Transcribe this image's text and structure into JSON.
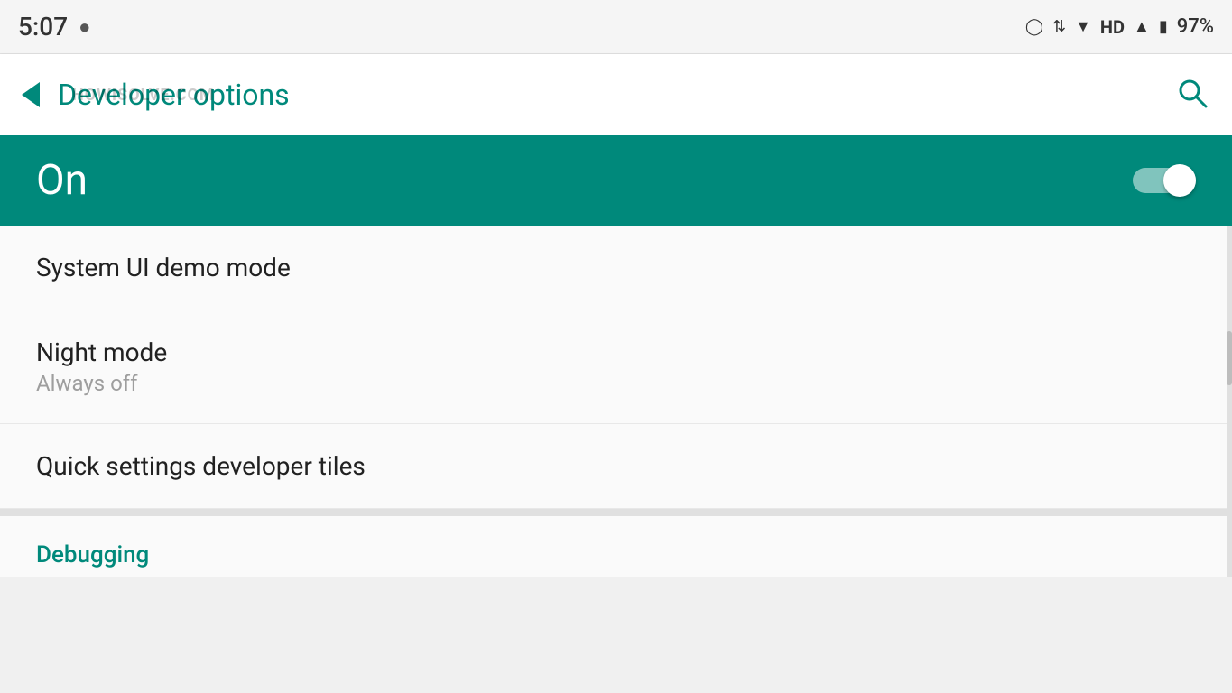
{
  "statusBar": {
    "time": "5:07",
    "batteryPercent": "97%",
    "icons": {
      "alarm": "⏰",
      "sort": "⇅",
      "wifi": "▾",
      "hd": "HD",
      "signal": "▲",
      "battery": "🔋"
    }
  },
  "appBar": {
    "title": "Developer options",
    "backLabel": "←",
    "searchLabel": "🔍"
  },
  "onBanner": {
    "label": "On",
    "toggleState": "on"
  },
  "settings": [
    {
      "id": "system-ui-demo",
      "title": "System UI demo mode",
      "subtitle": ""
    },
    {
      "id": "night-mode",
      "title": "Night mode",
      "subtitle": "Always off"
    },
    {
      "id": "quick-settings",
      "title": "Quick settings developer tiles",
      "subtitle": ""
    }
  ],
  "sections": [
    {
      "id": "debugging",
      "title": "Debugging"
    }
  ],
  "watermark": "HOWISOLVE.COM"
}
